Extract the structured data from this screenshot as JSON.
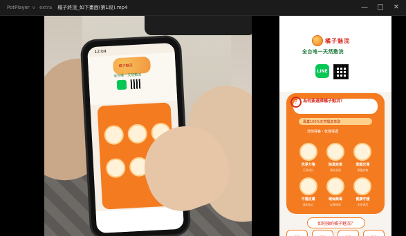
{
  "window": {
    "app_name": "PotPlayer",
    "chevron": "v",
    "menu_extra": "extra",
    "file_title": "橘子終浣_如下畫面(第1段).mp4",
    "controls": [
      "—",
      "□",
      "✕"
    ]
  },
  "phone": {
    "time": "12:04",
    "logo_text": "橘子魅浣",
    "slogan": "全台唯一天然敷浣"
  },
  "poster": {
    "brand": "橘子魅浣",
    "slogan": "全台唯一天然敷浣",
    "line_label": "LINE",
    "card_title": "為何要選擇橘子魅浣？",
    "card_sub": "專業100%天然橘皮萃取",
    "card_desc": "洗劑保養・乾燥保護",
    "features": [
      {
        "label": "洗淨力強",
        "sub": "天然成分"
      },
      {
        "label": "除臭效果",
        "sub": "清新香氣"
      },
      {
        "label": "柔順光澤",
        "sub": "保護衣物"
      },
      {
        "label": "不傷皮膚",
        "sub": "溫和安心"
      },
      {
        "label": "環保無毒",
        "sub": "友善地球"
      },
      {
        "label": "健康守護",
        "sub": "全家適用"
      }
    ],
    "tip": "如何預約橘子魅浣？",
    "steps": [
      "01",
      "02",
      "03",
      "04"
    ]
  },
  "colors": {
    "accent_orange": "#f47b20",
    "brand_red": "#d62b1e",
    "slogan_green": "#1d7a3a",
    "line_green": "#06c755"
  }
}
